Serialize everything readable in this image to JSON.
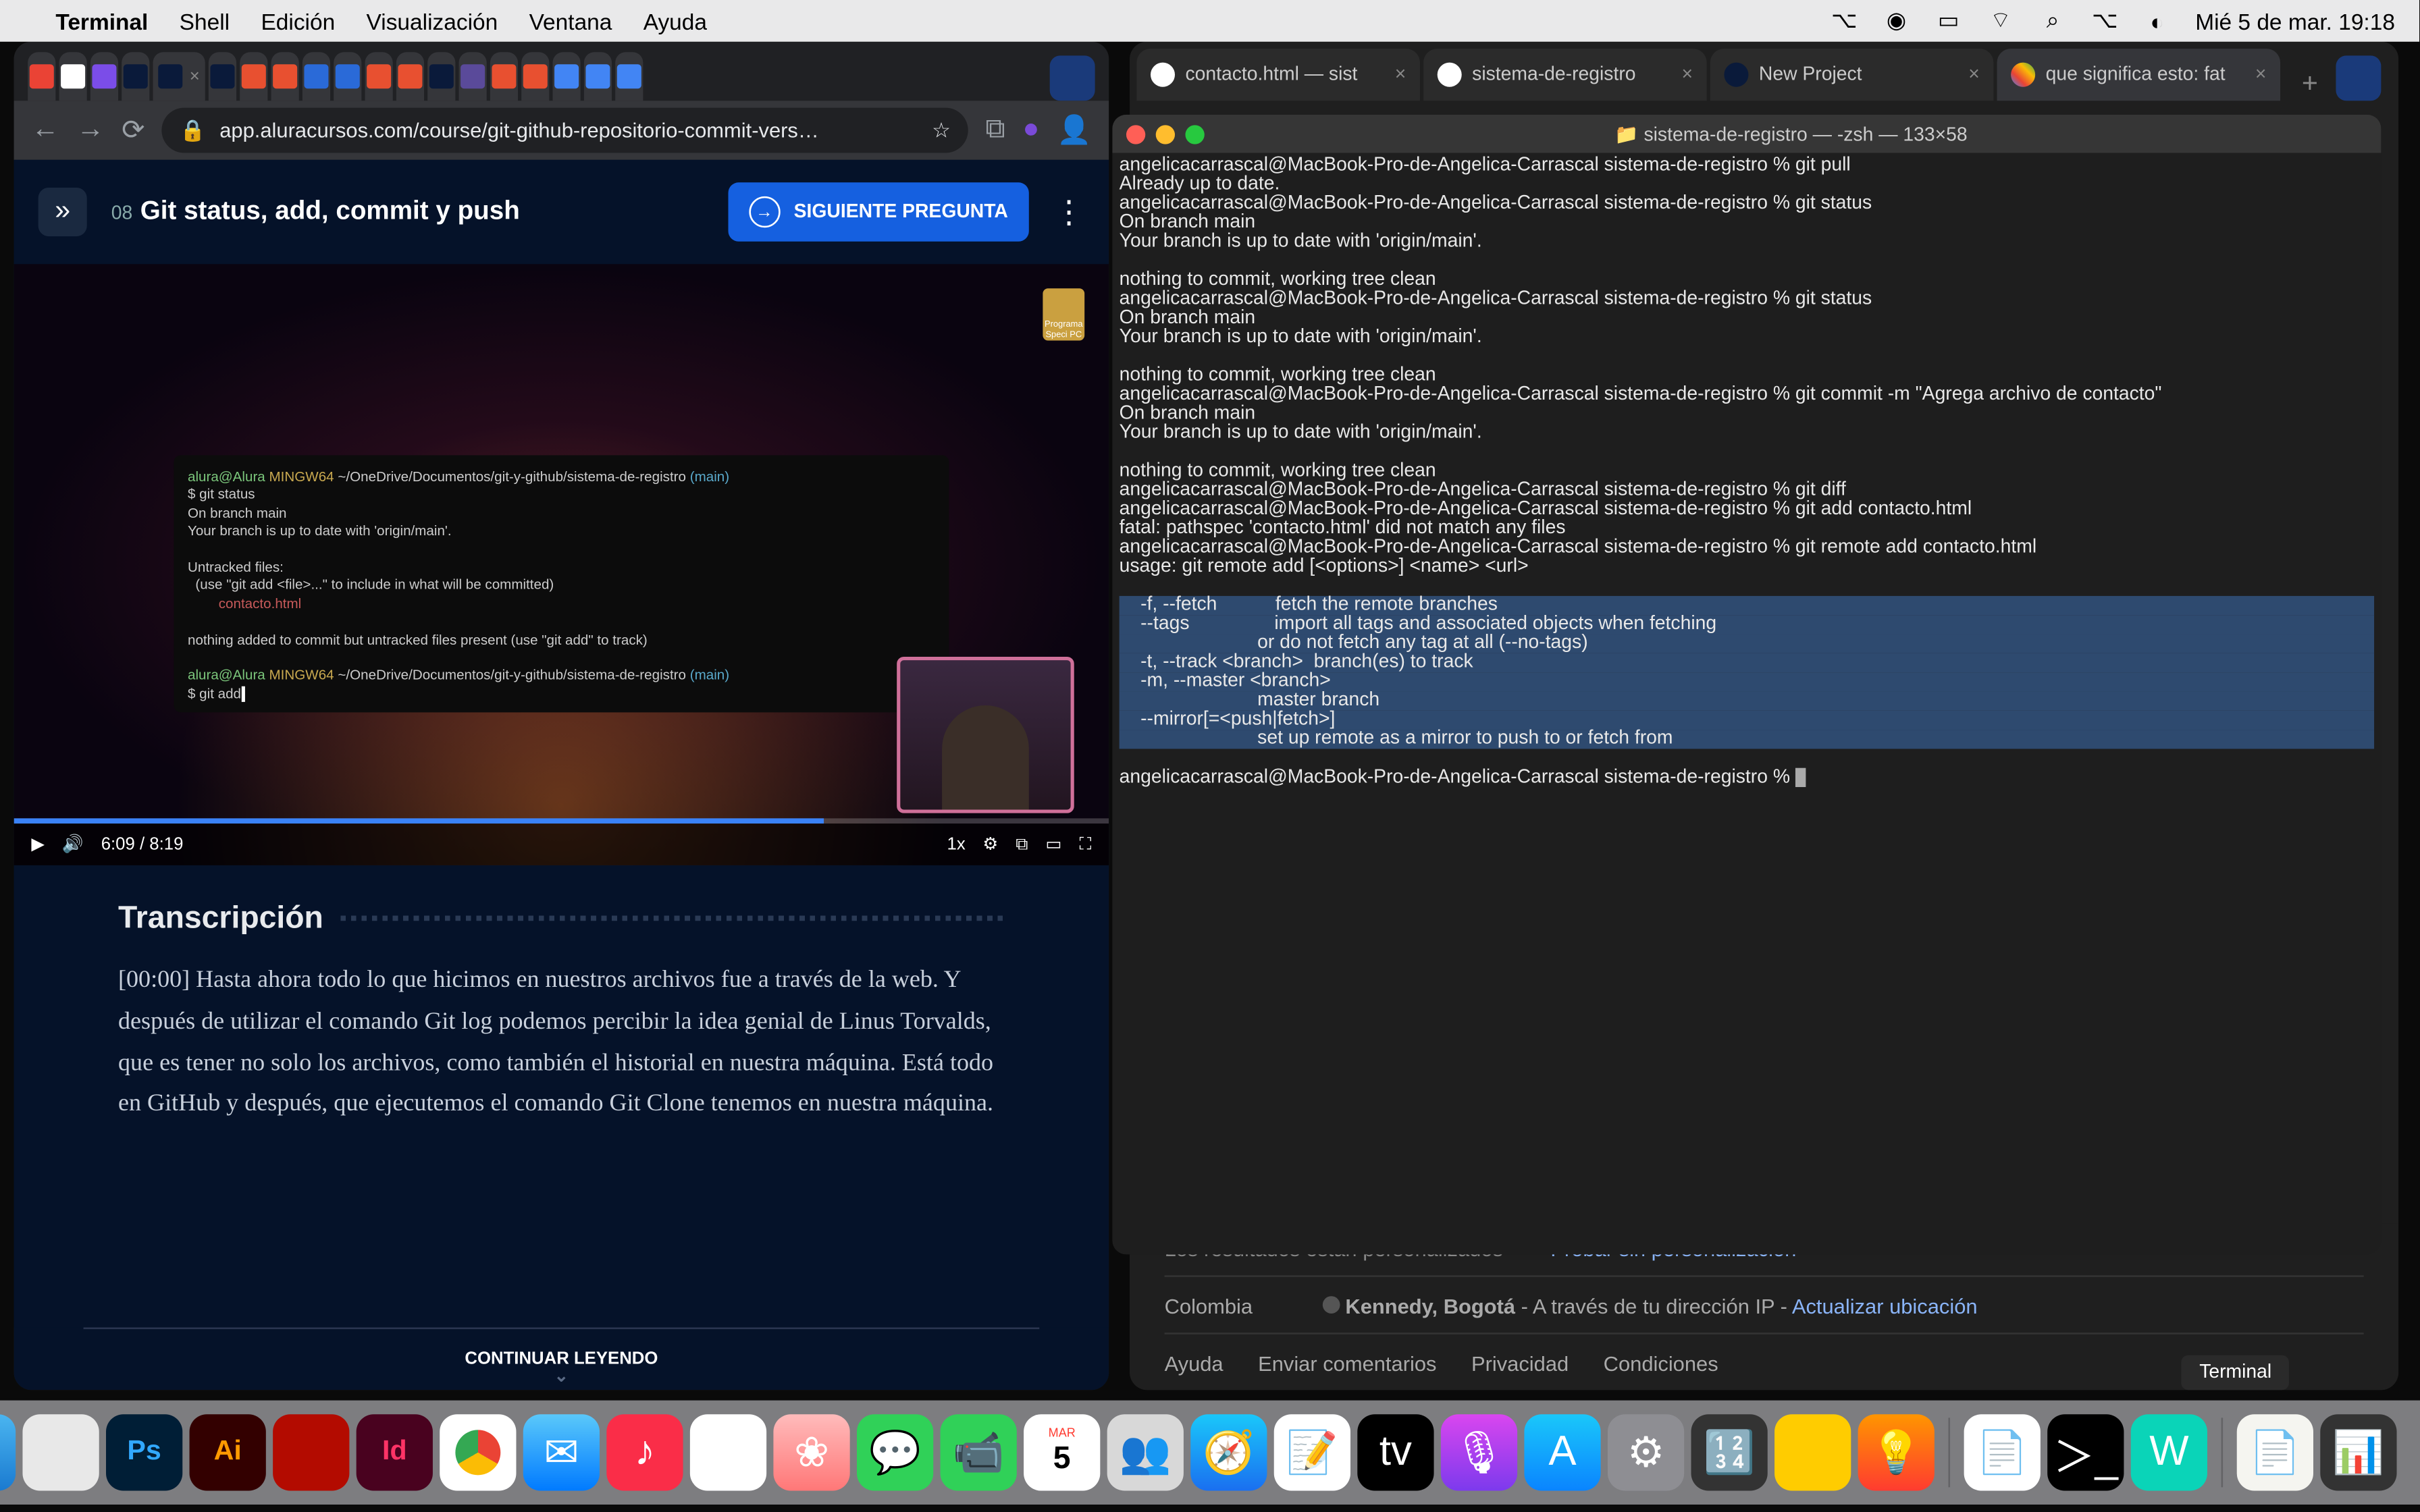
{
  "menubar": {
    "app": "Terminal",
    "items": [
      "Shell",
      "Edición",
      "Visualización",
      "Ventana",
      "Ayuda"
    ],
    "datetime": "Mié 5 de mar.  19:18"
  },
  "chrome_left": {
    "url": "app.aluracursos.com/course/git-github-repositorio-commit-vers…",
    "tabs_count": 21
  },
  "course": {
    "number": "08",
    "title": "Git status, add, commit y push",
    "next_btn": "SIGUIENTE PREGUNTA",
    "video": {
      "time": "6:09",
      "duration": "8:19",
      "speed": "1x",
      "badge": "Programa Speci PC",
      "terminal_lines": [
        {
          "cls": "vt-green",
          "txt": "alura@Alura "
        },
        {
          "cls": "vt-yellow",
          "txt": "MINGW64 ~/OneDrive/Documentos/git-y-github/sistema-de-registro "
        },
        {
          "cls": "vt-cyan",
          "txt": "(main)"
        }
      ],
      "terminal_full": "alura@Alura MINGW64 ~/OneDrive/Documentos/git-y-github/sistema-de-registro (main)\n$ git status\nOn branch main\nYour branch is up to date with 'origin/main'.\n\nUntracked files:\n  (use \"git add <file>...\" to include in what will be committed)\n        contacto.html\n\nnothing added to commit but untracked files present (use \"git add\" to track)\n\nalura@Alura MINGW64 ~/OneDrive/Documentos/git-y-github/sistema-de-registro (main)\n$ git add"
    },
    "transcript_heading": "Transcripción",
    "transcript_body": "[00:00] Hasta ahora todo lo que hicimos en nuestros archivos fue a través de la web. Y después de utilizar el comando Git log podemos percibir la idea genial de Linus Torvalds, que es tener no solo los archivos, como también el historial en nuestra máquina. Está todo en GitHub y después, que ejecutemos el comando Git Clone tenemos en nuestra máquina.",
    "continue": "CONTINUAR LEYENDO"
  },
  "terminal": {
    "title": "sistema-de-registro — -zsh — 133×58",
    "lines": [
      "angelicacarrascal@MacBook-Pro-de-Angelica-Carrascal sistema-de-registro % git pull",
      "Already up to date.",
      "angelicacarrascal@MacBook-Pro-de-Angelica-Carrascal sistema-de-registro % git status",
      "On branch main",
      "Your branch is up to date with 'origin/main'.",
      "",
      "nothing to commit, working tree clean",
      "angelicacarrascal@MacBook-Pro-de-Angelica-Carrascal sistema-de-registro % git status",
      "On branch main",
      "Your branch is up to date with 'origin/main'.",
      "",
      "nothing to commit, working tree clean",
      "angelicacarrascal@MacBook-Pro-de-Angelica-Carrascal sistema-de-registro % git commit -m \"Agrega archivo de contacto\"",
      "On branch main",
      "Your branch is up to date with 'origin/main'.",
      "",
      "nothing to commit, working tree clean",
      "angelicacarrascal@MacBook-Pro-de-Angelica-Carrascal sistema-de-registro % git diff",
      "angelicacarrascal@MacBook-Pro-de-Angelica-Carrascal sistema-de-registro % git add contacto.html",
      "fatal: pathspec 'contacto.html' did not match any files",
      "angelicacarrascal@MacBook-Pro-de-Angelica-Carrascal sistema-de-registro % git remote add contacto.html",
      "usage: git remote add [<options>] <name> <url>",
      "",
      "    -f, --fetch           fetch the remote branches",
      "    --tags                import all tags and associated objects when fetching",
      "                          or do not fetch any tag at all (--no-tags)",
      "    -t, --track <branch>  branch(es) to track",
      "    -m, --master <branch>",
      "                          master branch",
      "    --mirror[=<push|fetch>]",
      "                          set up remote as a mirror to push to or fetch from",
      "",
      "angelicacarrascal@MacBook-Pro-de-Angelica-Carrascal sistema-de-registro % "
    ],
    "selected_range": [
      23,
      30
    ]
  },
  "chrome_right": {
    "tabs": [
      {
        "label": "contacto.html — sist",
        "icon": "github"
      },
      {
        "label": "sistema-de-registro",
        "icon": "github"
      },
      {
        "label": "New Project",
        "icon": "alura"
      },
      {
        "label": "que significa esto: fat",
        "icon": "google",
        "active": true
      }
    ],
    "footer": {
      "personalized": "Los resultados están personalizados -",
      "try": "Probar sin personalización",
      "country": "Colombia",
      "loc_label": "Kennedy, Bogotá",
      "loc_via": " - A través de tu dirección IP - ",
      "loc_update": "Actualizar ubicación",
      "links": [
        "Ayuda",
        "Enviar comentarios",
        "Privacidad",
        "Condiciones"
      ]
    }
  },
  "dock": {
    "tooltip": "Terminal",
    "items": [
      "finder",
      "launchpad",
      "photoshop",
      "illustrator",
      "acrobat",
      "indesign",
      "chrome",
      "mail",
      "music",
      "maps",
      "photos",
      "messages",
      "facetime",
      "calendar",
      "contacts",
      "safari",
      "notes",
      "appletv",
      "podcasts",
      "appstore",
      "settings",
      "calculator",
      "notes2",
      "tips"
    ],
    "right_items": [
      "textedit",
      "pages",
      "ibooks",
      "terminal",
      "terminal2",
      "notes-app",
      "trash"
    ]
  }
}
